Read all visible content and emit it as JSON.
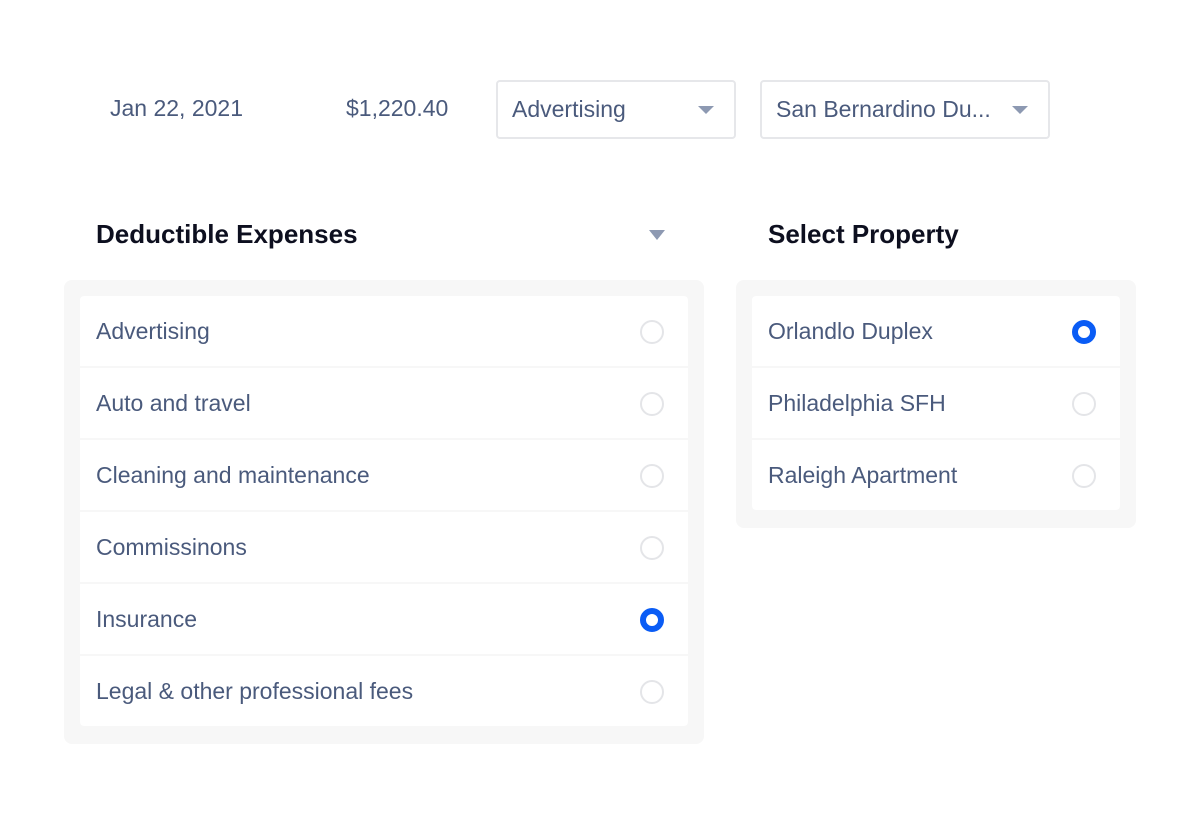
{
  "transaction": {
    "date": "Jan 22, 2021",
    "amount": "$1,220.40",
    "category_select": {
      "value": "Advertising",
      "icon": "caret-down-icon"
    },
    "property_select": {
      "value": "San Bernardino Du...",
      "icon": "caret-down-icon"
    }
  },
  "deductible_expenses": {
    "title": "Deductible Expenses",
    "toggle_icon": "caret-down-icon",
    "items": [
      {
        "label": "Advertising",
        "selected": false
      },
      {
        "label": "Auto and travel",
        "selected": false
      },
      {
        "label": "Cleaning and maintenance",
        "selected": false
      },
      {
        "label": "Commissinons",
        "selected": false
      },
      {
        "label": "Insurance",
        "selected": true
      },
      {
        "label": "Legal & other professional fees",
        "selected": false
      }
    ]
  },
  "select_property": {
    "title": "Select Property",
    "items": [
      {
        "label": "Orlandlo Duplex",
        "selected": true
      },
      {
        "label": "Philadelphia SFH",
        "selected": false
      },
      {
        "label": "Raleigh Apartment",
        "selected": false
      }
    ]
  },
  "colors": {
    "accent": "#0a5cf5",
    "text": "#4a5a7c",
    "heading": "#0d0f1f",
    "panel_bg": "#f7f7f7",
    "border": "#e6e7ea",
    "caret": "#8d99b2"
  }
}
